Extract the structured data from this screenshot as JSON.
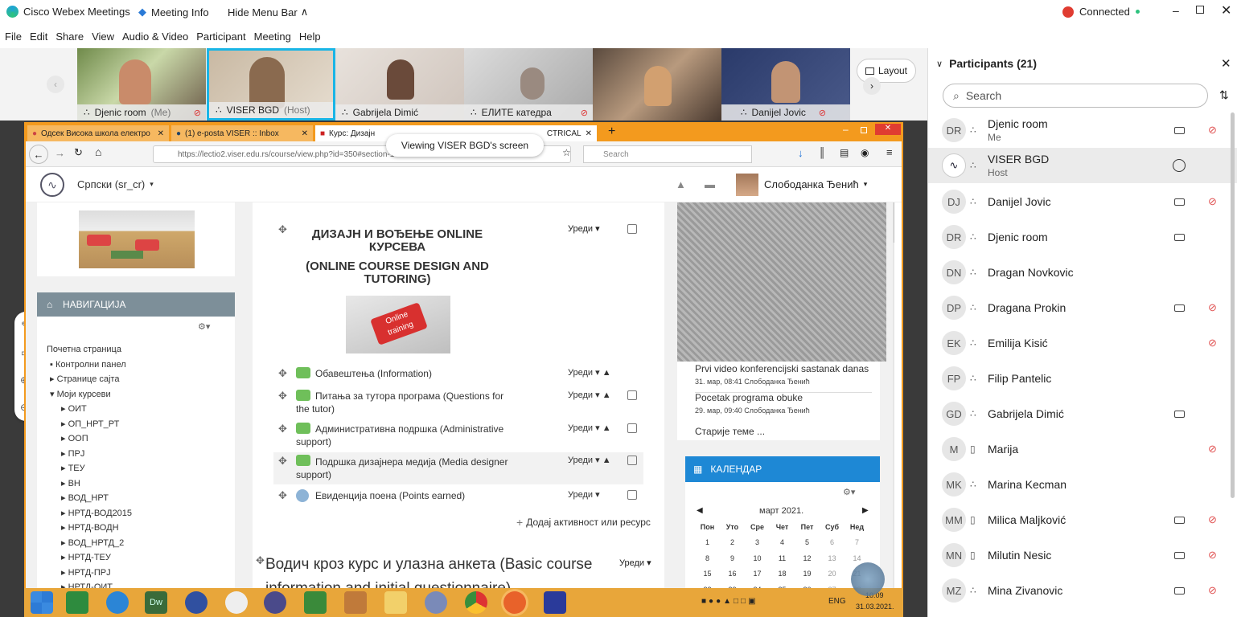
{
  "window": {
    "app_title": "Cisco Webex Meetings",
    "meeting_info": "Meeting Info",
    "hide_menu": "Hide Menu Bar",
    "connected": "Connected"
  },
  "menu": [
    "File",
    "Edit",
    "Share",
    "View",
    "Audio & Video",
    "Participant",
    "Meeting",
    "Help"
  ],
  "video_tiles": [
    {
      "name": "Djenic room",
      "suffix": "(Me)",
      "muted": true
    },
    {
      "name": "VISER BGD",
      "suffix": "(Host)",
      "muted": false
    },
    {
      "name": "Gabrijela Dimić",
      "suffix": "",
      "muted": false
    },
    {
      "name": "ЕЛИТЕ катедра",
      "suffix": "",
      "muted": true
    },
    {
      "name": "",
      "suffix": "",
      "muted": false
    },
    {
      "name": "Danijel Jovic",
      "suffix": "",
      "muted": true
    }
  ],
  "layout_label": "Layout",
  "viewing_label": "Viewing VISER BGD's screen",
  "browser": {
    "tabs": [
      "Одсек Висока школа електро",
      "(1) e-posta VISER :: Inbox",
      "Курс: Дизајн",
      "CTRICAL"
    ],
    "url": "https://lectio2.viser.edu.rs/course/view.php?id=350#section-1",
    "search_placeholder": "Search"
  },
  "moodle": {
    "language": "Српски (sr_cr)",
    "user": "Слободанка Ђенић",
    "nav_title": "НАВИГАЦИЈА",
    "nav_items": [
      "Почетна страница",
      "Контролни панел",
      "Странице сајта",
      "Моји курсеви",
      "ОИТ",
      "ОП_НРТ_РТ",
      "ООП",
      "ПРЈ",
      "ТЕУ",
      "ВН",
      "ВОД_НРТ",
      "НРТД-ВОД2015",
      "НРТД-ВОДН",
      "ВОД_НРТД_2",
      "НРТД-ТЕУ",
      "НРТД-ПРЈ",
      "НРТД-ОИТ"
    ],
    "course_title_1": "ДИЗАЈН И ВОЂЕЊЕ ONLINE КУРСЕВА",
    "course_title_2": "(ONLINE COURSE DESIGN AND TUTORING)",
    "banner_text": "Online training",
    "edit_label": "Уреди",
    "activities": [
      "Обавештења (Information)",
      "Питања за тутора програма (Questions for the tutor)",
      "Административна подршка (Administrative support)",
      "Подршка дизајнера медија (Media designer support)",
      "Евиденција поена (Points earned)"
    ],
    "add_activity": "Додај активност или ресурс",
    "section2_title": "Водич кроз курс и улазна анкета (Basic course information and initial questionnaire)",
    "news": [
      {
        "title": "Prvi video konferencijski sastanak danas",
        "meta": "31. мар, 08:41  Слободанка Ђенић"
      },
      {
        "title": "Pocetak programa obuke",
        "meta": "29. мар, 09:40  Слободанка Ђенић"
      }
    ],
    "older_topics": "Старије теме ...",
    "calendar_title": "КАЛЕНДАР",
    "calendar_month": "март 2021.",
    "weekdays": [
      "Пон",
      "Уто",
      "Сре",
      "Чет",
      "Пет",
      "Суб",
      "Нед"
    ],
    "weeks": [
      [
        "1",
        "2",
        "3",
        "4",
        "5",
        "6",
        "7"
      ],
      [
        "8",
        "9",
        "10",
        "11",
        "12",
        "13",
        "14"
      ],
      [
        "15",
        "16",
        "17",
        "18",
        "19",
        "20",
        "21"
      ],
      [
        "22",
        "23",
        "24",
        "25",
        "26",
        "27",
        "28"
      ]
    ]
  },
  "taskbar": {
    "lang": "ENG",
    "time": "10:09",
    "date": "31.03.2021."
  },
  "participants": {
    "title": "Participants (21)",
    "search_placeholder": "Search",
    "list": [
      {
        "initials": "DR",
        "name": "Djenic room",
        "sub": "Me",
        "cam": true,
        "muted": true
      },
      {
        "initials": "",
        "name": "VISER BGD",
        "sub": "Host",
        "cam": false,
        "muted": false
      },
      {
        "initials": "DJ",
        "name": "Danijel Jovic",
        "sub": "",
        "cam": true,
        "muted": true
      },
      {
        "initials": "DR",
        "name": "Djenic room",
        "sub": "",
        "cam": true,
        "muted": false
      },
      {
        "initials": "DN",
        "name": "Dragan Novkovic",
        "sub": "",
        "cam": false,
        "muted": false
      },
      {
        "initials": "DP",
        "name": "Dragana Prokin",
        "sub": "",
        "cam": true,
        "muted": true
      },
      {
        "initials": "EK",
        "name": "Emilija Kisić",
        "sub": "",
        "cam": false,
        "muted": true
      },
      {
        "initials": "FP",
        "name": "Filip Pantelic",
        "sub": "",
        "cam": false,
        "muted": false
      },
      {
        "initials": "GD",
        "name": "Gabrijela Dimić",
        "sub": "",
        "cam": true,
        "muted": false
      },
      {
        "initials": "M",
        "name": "Marija",
        "sub": "",
        "cam": false,
        "muted": true
      },
      {
        "initials": "MK",
        "name": "Marina Kecman",
        "sub": "",
        "cam": false,
        "muted": false
      },
      {
        "initials": "MM",
        "name": "Milica Maljković",
        "sub": "",
        "cam": true,
        "muted": true
      },
      {
        "initials": "MN",
        "name": "Milutin Nesic",
        "sub": "",
        "cam": true,
        "muted": true
      },
      {
        "initials": "MZ",
        "name": "Mina Zivanovic",
        "sub": "",
        "cam": true,
        "muted": true
      }
    ]
  }
}
